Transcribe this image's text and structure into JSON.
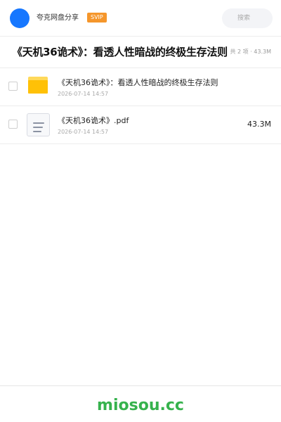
{
  "header": {
    "username": "夸克网盘分享",
    "badge": "SVIP",
    "search_placeholder": "搜索"
  },
  "share": {
    "title": "《天机36诡术》：看透人性暗战的终极生存法则",
    "meta": "共 2 项 · 43.3M"
  },
  "files": [
    {
      "name": "《天机36诡术》：看透人性暗战的终极生存法则",
      "date": "2026-07-14 14:57",
      "size": "",
      "icon": "folder-icon"
    },
    {
      "name": "《天机36诡术》.pdf",
      "date": "2026-07-14 14:57",
      "size": "43.3M",
      "icon": "pdf-document-icon"
    }
  ],
  "footer": {
    "watermark": "miosou.cc"
  },
  "colors": {
    "avatar": "#1677ff",
    "badge": "#f5962b",
    "folder": "#ffc107",
    "watermark": "#36b24d"
  }
}
